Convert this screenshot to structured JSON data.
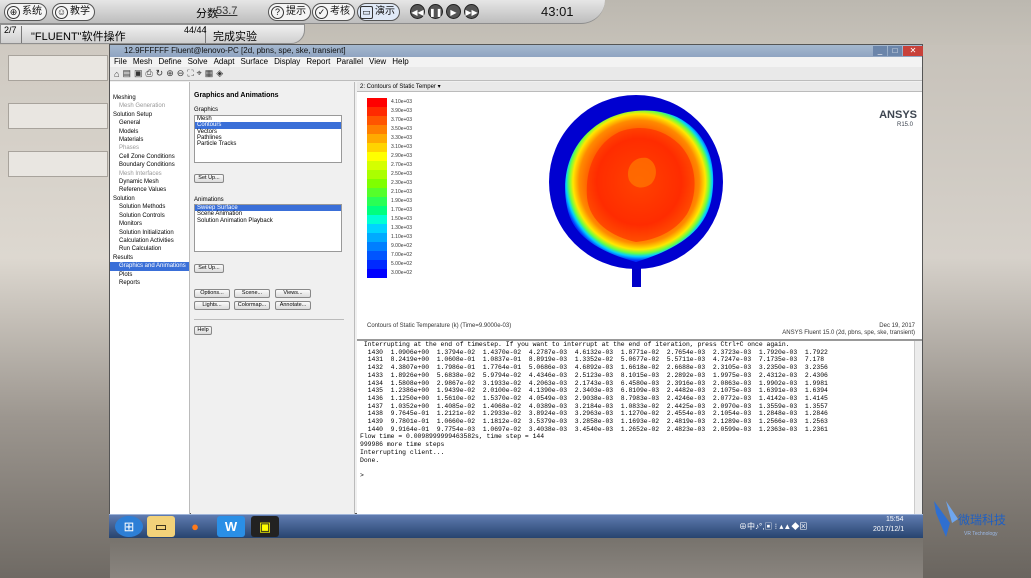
{
  "sim": {
    "system_label": "系统",
    "teach_label": "教学",
    "score_label": "分数",
    "score_value": "53.7",
    "hint_label": "提示",
    "exam_label": "考核",
    "demo_label": "演示",
    "timer": "43:01",
    "step_num": "2",
    "step_den": "7",
    "step_title": "\"FLUENT\"软件操作",
    "sub_num": "44",
    "sub_den": "44",
    "sub_title": "完成实验"
  },
  "app": {
    "title": "12.9FFFFFF Fluent@lenovo-PC  [2d, pbns, spe, ske, transient]",
    "menu": [
      "File",
      "Mesh",
      "Define",
      "Solve",
      "Adapt",
      "Surface",
      "Display",
      "Report",
      "Parallel",
      "View",
      "Help"
    ]
  },
  "nav": [
    {
      "label": "Meshing",
      "level": 1,
      "state": "normal"
    },
    {
      "label": "Mesh Generation",
      "level": 2,
      "state": "dim"
    },
    {
      "label": "Solution Setup",
      "level": 1,
      "state": "normal"
    },
    {
      "label": "General",
      "level": 2,
      "state": "normal"
    },
    {
      "label": "Models",
      "level": 2,
      "state": "normal"
    },
    {
      "label": "Materials",
      "level": 2,
      "state": "normal"
    },
    {
      "label": "Phases",
      "level": 2,
      "state": "dim"
    },
    {
      "label": "Cell Zone Conditions",
      "level": 2,
      "state": "normal"
    },
    {
      "label": "Boundary Conditions",
      "level": 2,
      "state": "normal"
    },
    {
      "label": "Mesh Interfaces",
      "level": 2,
      "state": "dim"
    },
    {
      "label": "Dynamic Mesh",
      "level": 2,
      "state": "normal"
    },
    {
      "label": "Reference Values",
      "level": 2,
      "state": "normal"
    },
    {
      "label": "Solution",
      "level": 1,
      "state": "normal"
    },
    {
      "label": "Solution Methods",
      "level": 2,
      "state": "normal"
    },
    {
      "label": "Solution Controls",
      "level": 2,
      "state": "normal"
    },
    {
      "label": "Monitors",
      "level": 2,
      "state": "normal"
    },
    {
      "label": "Solution Initialization",
      "level": 2,
      "state": "normal"
    },
    {
      "label": "Calculation Activities",
      "level": 2,
      "state": "normal"
    },
    {
      "label": "Run Calculation",
      "level": 2,
      "state": "normal"
    },
    {
      "label": "Results",
      "level": 1,
      "state": "normal"
    },
    {
      "label": "Graphics and Animations",
      "level": 2,
      "state": "sel"
    },
    {
      "label": "Plots",
      "level": 2,
      "state": "normal"
    },
    {
      "label": "Reports",
      "level": 2,
      "state": "normal"
    }
  ],
  "task": {
    "heading": "Graphics and Animations",
    "graphics_label": "Graphics",
    "graphics_items": [
      "Mesh",
      "Contours",
      "Vectors",
      "Pathlines",
      "Particle Tracks"
    ],
    "graphics_selected": 1,
    "setup1": "Set Up...",
    "anim_label": "Animations",
    "anim_items": [
      "Sweep Surface",
      "Scene Animation",
      "Solution Animation Playback"
    ],
    "anim_selected": 0,
    "setup2": "Set Up...",
    "options": "Options...",
    "scene": "Scene...",
    "views": "Views...",
    "lights": "Lights...",
    "colormap": "Colormap...",
    "annotate": "Annotate...",
    "help": "Help"
  },
  "graphics": {
    "tab": "2: Contours of Static Temper",
    "brand": "ANSYS",
    "version": "R15.0",
    "legend": [
      "4.10e+03",
      "3.90e+03",
      "3.70e+03",
      "3.50e+03",
      "3.30e+03",
      "3.10e+03",
      "2.90e+03",
      "2.70e+03",
      "2.50e+03",
      "2.30e+03",
      "2.10e+03",
      "1.90e+03",
      "1.70e+03",
      "1.50e+03",
      "1.30e+03",
      "1.10e+03",
      "9.00e+02",
      "7.00e+02",
      "5.00e+02",
      "3.00e+02"
    ],
    "caption": "Contours of Static Temperature (k)  (Time=9.9000e-03)",
    "date": "Dec 19, 2017",
    "solver": "ANSYS Fluent 15.0 (2d, pbns, spe, ske, transient)"
  },
  "console": {
    "lines": [
      " Interrupting at the end of timestep. If you want to interrupt at the end of iteration, press Ctrl+C once again.",
      "  1430  1.0906e+00  1.3794e-02  1.4370e-02  4.2787e-03  4.6132e-03  1.8771e-02  2.7654e-03  2.3723e-03  1.7920e-03  1.7922",
      "  1431  8.2419e+00  1.0608e-01  1.0837e-01  8.8919e-03  1.3352e-02  5.0677e-02  5.5711e-03  4.7247e-03  7.1735e-03  7.178",
      "  1432  4.3807e+00  1.7986e-01  1.7764e-01  5.0686e-03  4.6892e-03  1.6618e-02  2.6688e-03  2.3105e-03  3.2350e-03  3.2356",
      "  1433  1.8926e+00  5.6838e-02  5.9794e-02  4.4346e-03  2.5123e-03  8.1015e-03  2.2892e-03  1.9975e-03  2.4312e-03  2.4306",
      "  1434  1.5808e+00  2.9867e-02  3.1933e-02  4.2063e-03  2.1743e-03  6.4580e-03  2.3916e-03  2.0863e-03  1.9902e-03  1.9981",
      "  1435  1.2386e+00  1.9439e-02  2.0100e-02  4.1390e-03  2.3403e-03  6.8109e-03  2.4482e-03  2.1075e-03  1.6391e-03  1.6394",
      "  1436  1.1250e+00  1.5610e-02  1.5370e-02  4.0549e-03  2.9038e-03  8.7983e-03  2.4246e-03  2.0772e-03  1.4142e-03  1.4145",
      "  1437  1.0352e+00  1.4085e-02  1.4068e-02  4.0389e-03  3.2184e-03  1.0833e-02  2.4425e-03  2.0970e-03  1.3559e-03  1.3557",
      "  1438  9.7645e-01  1.2121e-02  1.2933e-02  3.8924e-03  3.2963e-03  1.1270e-02  2.4554e-03  2.1054e-03  1.2848e-03  1.2846",
      "  1439  9.7801e-01  1.0660e-02  1.1812e-02  3.5379e-03  3.2858e-03  1.1693e-02  2.4819e-03  2.1289e-03  1.2566e-03  1.2563",
      "  1440  9.9164e-01  9.7754e-03  1.0697e-02  3.4038e-03  3.4540e-03  1.2652e-02  2.4823e-03  2.0599e-03  1.2363e-03  1.2361",
      "Flow time = 0.0098999999463582s, time step = 144",
      "999986 more time steps",
      "Interrupting client...",
      "Done.",
      "",
      ">"
    ]
  },
  "clock": {
    "time": "15:54",
    "date": "2017/12/1"
  },
  "brand_logo": {
    "cn": "微瑞科技",
    "en": "VR Technology"
  }
}
